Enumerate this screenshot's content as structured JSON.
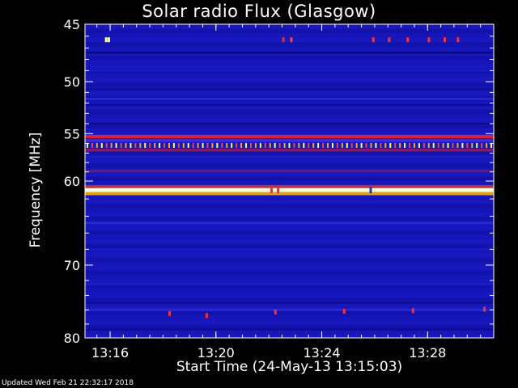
{
  "chart_data": {
    "type": "heatmap",
    "title": "Solar radio Flux (Glasgow)",
    "xlabel": "Start Time (24-May-13 13:15:03)",
    "ylabel": "Frequency [MHz]",
    "x_unit": "minutes after 13:15:03",
    "xlim": [
      0,
      15.45
    ],
    "ylim": [
      45,
      80
    ],
    "y_scale": "log",
    "x_ticks": [
      {
        "value": 0.95,
        "label": "13:16"
      },
      {
        "value": 4.95,
        "label": "13:20"
      },
      {
        "value": 8.95,
        "label": "13:24"
      },
      {
        "value": 12.95,
        "label": "13:28"
      }
    ],
    "y_ticks": [
      {
        "value": 45,
        "label": "45"
      },
      {
        "value": 50,
        "label": "50"
      },
      {
        "value": 55,
        "label": "55"
      },
      {
        "value": 60,
        "label": "60"
      },
      {
        "value": 70,
        "label": "70"
      },
      {
        "value": 80,
        "label": "80"
      }
    ],
    "background_color": "#1414b4",
    "bands": [
      {
        "freq_mhz": 47.4,
        "intensity": 0.35,
        "color": "#0a0a8c"
      },
      {
        "freq_mhz": 49.0,
        "intensity": 0.2,
        "color": "#1c1cc8"
      },
      {
        "freq_mhz": 50.7,
        "intensity": 0.25,
        "color": "#0f0f9a"
      },
      {
        "freq_mhz": 51.6,
        "intensity": 0.3,
        "color": "#2828d8"
      },
      {
        "freq_mhz": 52.2,
        "intensity": 0.2,
        "color": "#0c0c90"
      },
      {
        "freq_mhz": 54.0,
        "intensity": 0.2,
        "color": "#0c0c90"
      },
      {
        "freq_mhz": 55.3,
        "intensity": 0.75,
        "color": "#d8203c"
      },
      {
        "freq_mhz": 55.7,
        "intensity": 0.55,
        "color": "#4030d8"
      },
      {
        "freq_mhz": 56.7,
        "intensity": 0.5,
        "color": "#8a1a6a"
      },
      {
        "freq_mhz": 57.4,
        "intensity": 0.25,
        "color": "#2020c0"
      },
      {
        "freq_mhz": 58.9,
        "intensity": 0.35,
        "color": "#5a1f8a"
      },
      {
        "freq_mhz": 60.6,
        "intensity": 0.6,
        "color": "#c03030"
      },
      {
        "freq_mhz": 61.0,
        "intensity": 1.0,
        "color": "#ffffd8"
      },
      {
        "freq_mhz": 61.4,
        "intensity": 0.7,
        "color": "#e0a020"
      },
      {
        "freq_mhz": 64.8,
        "intensity": 0.3,
        "color": "#2a2ae0"
      },
      {
        "freq_mhz": 68.0,
        "intensity": 0.2,
        "color": "#1c1cc8"
      },
      {
        "freq_mhz": 72.5,
        "intensity": 0.15,
        "color": "#2020d0"
      },
      {
        "freq_mhz": 75.0,
        "intensity": 0.25,
        "color": "#0c0c90"
      },
      {
        "freq_mhz": 76.0,
        "intensity": 0.3,
        "color": "#2a2ad8"
      },
      {
        "freq_mhz": 78.8,
        "intensity": 0.2,
        "color": "#0c0c90"
      }
    ],
    "bursts": [
      {
        "time_min": 0.8,
        "freq_mhz": 46.3,
        "color": "#ffff80"
      },
      {
        "time_min": 0.9,
        "freq_mhz": 46.3,
        "color": "#ffff80"
      },
      {
        "time_min": 7.5,
        "freq_mhz": 46.3,
        "color": "#ff2020"
      },
      {
        "time_min": 7.8,
        "freq_mhz": 46.3,
        "color": "#ff4040"
      },
      {
        "time_min": 10.9,
        "freq_mhz": 46.3,
        "color": "#ff3030"
      },
      {
        "time_min": 11.5,
        "freq_mhz": 46.3,
        "color": "#ff3030"
      },
      {
        "time_min": 12.2,
        "freq_mhz": 46.3,
        "color": "#ff3030"
      },
      {
        "time_min": 13.0,
        "freq_mhz": 46.3,
        "color": "#ff3030"
      },
      {
        "time_min": 13.6,
        "freq_mhz": 46.3,
        "color": "#ff3030"
      },
      {
        "time_min": 14.1,
        "freq_mhz": 46.3,
        "color": "#ff3030"
      },
      {
        "time_min": 3.2,
        "freq_mhz": 76.5,
        "color": "#ff3030"
      },
      {
        "time_min": 4.6,
        "freq_mhz": 76.8,
        "color": "#ff3030"
      },
      {
        "time_min": 7.2,
        "freq_mhz": 76.3,
        "color": "#ff3030"
      },
      {
        "time_min": 9.8,
        "freq_mhz": 76.2,
        "color": "#ff3030"
      },
      {
        "time_min": 12.4,
        "freq_mhz": 76.1,
        "color": "#ff3030"
      },
      {
        "time_min": 15.1,
        "freq_mhz": 75.9,
        "color": "#ff3030"
      }
    ],
    "periodic_feature": {
      "freq_mhz": 56.2,
      "count": 85,
      "colors": [
        "#ffff60",
        "#ff4040",
        "#ffa020"
      ]
    },
    "dropouts": [
      {
        "time_min": 7.05,
        "freq_mhz": 61.0,
        "color": "#d04040"
      },
      {
        "time_min": 7.3,
        "freq_mhz": 61.0,
        "color": "#d04040"
      },
      {
        "time_min": 10.8,
        "freq_mhz": 61.0,
        "color": "#3030a0"
      }
    ]
  },
  "footer": {
    "updated": "Updated Wed Feb 21 22:32:17 2018"
  }
}
